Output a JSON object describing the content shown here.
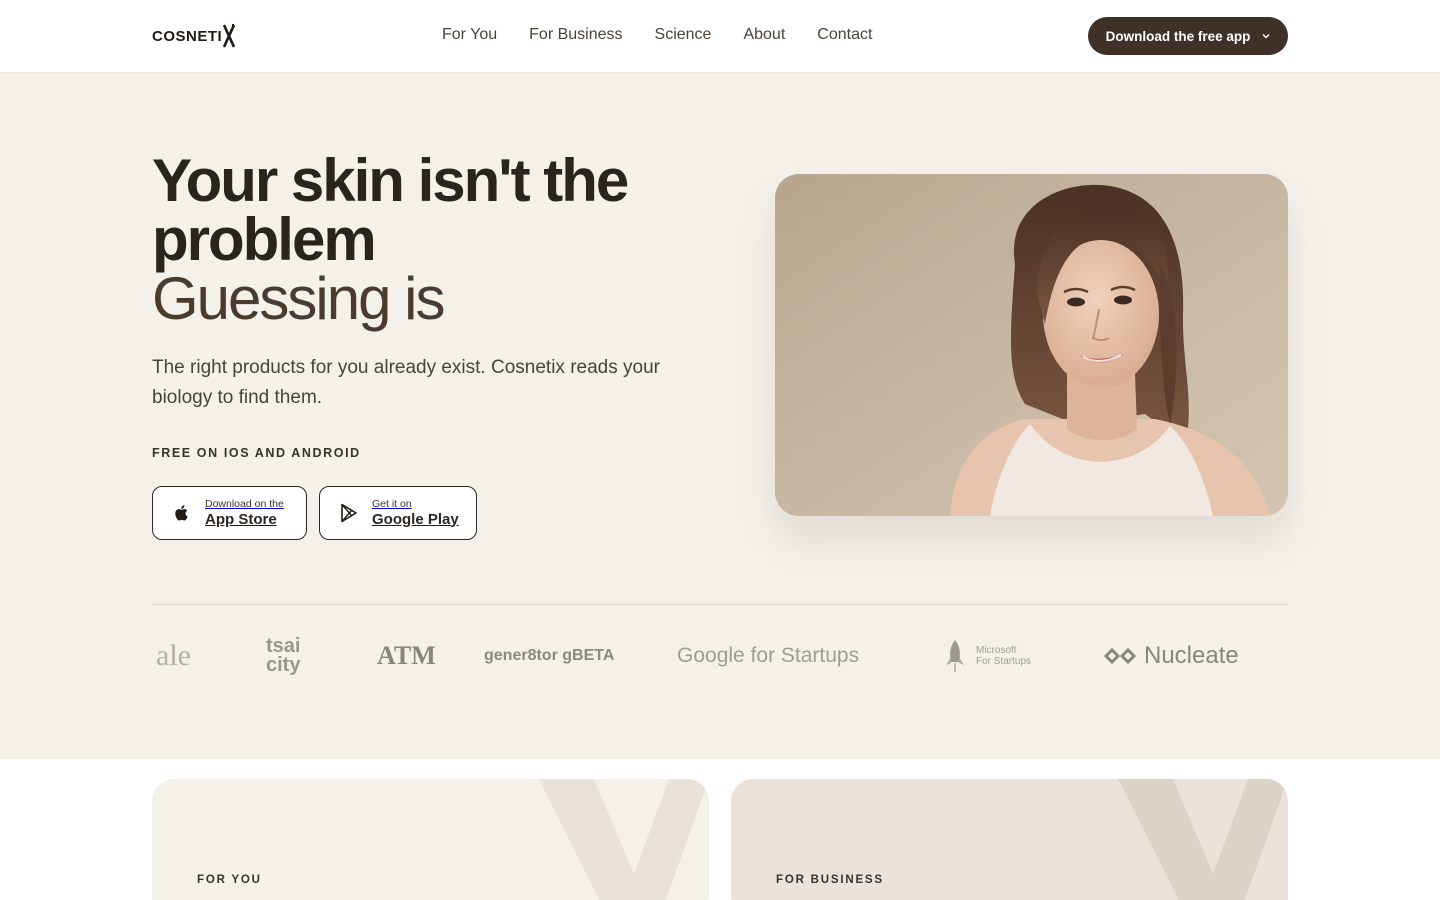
{
  "header": {
    "logo_text": "COSNETI",
    "nav": [
      "For You",
      "For Business",
      "Science",
      "About",
      "Contact"
    ],
    "cta_label": "Download the free app"
  },
  "hero": {
    "headline_line1": "Your skin isn't the problem",
    "headline_line2": "Guessing is",
    "subtext": "The right products for you already exist. Cosnetix reads your biology to find them.",
    "availability": "FREE ON IOS AND ANDROID",
    "app_store": {
      "small": "Download on the",
      "big": "App Store"
    },
    "google_play": {
      "small": "Get it on",
      "big": "Google Play"
    },
    "photo_icon": "smiling-woman-portrait"
  },
  "partners": {
    "yale": "ale",
    "tsai_line1": "tsai",
    "tsai_line2": "city",
    "texas_am": "ATM",
    "gener8tor": "gener8tor gBETA",
    "google": "Google for Startups",
    "microsoft_line1": "Microsoft",
    "microsoft_line2": "For Startups",
    "nucleate": "Nucleate"
  },
  "cards": {
    "for_you": "FOR YOU",
    "for_business": "FOR BUSINESS"
  },
  "colors": {
    "brand_dark": "#3f3128",
    "hero_bg": "#f4f1eb",
    "card_biz_bg": "#ebe3d9"
  }
}
